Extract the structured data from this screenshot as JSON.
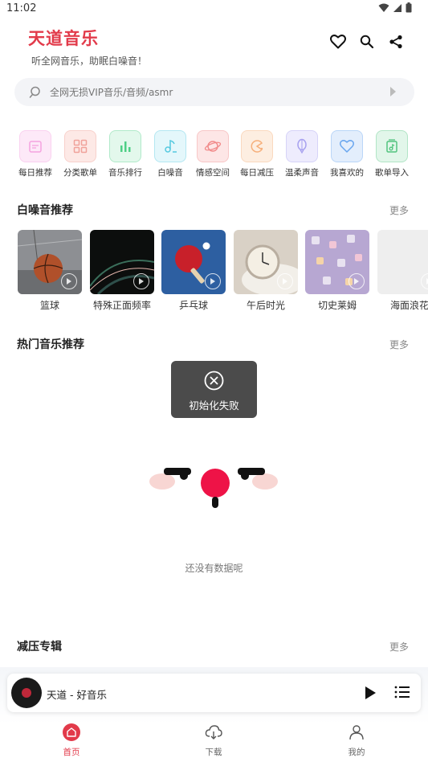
{
  "status": {
    "time": "11:02"
  },
  "header": {
    "title": "天道音乐",
    "subtitle": "听全网音乐，助眠白噪音！"
  },
  "search": {
    "placeholder": "全网无损VIP音乐/音频/asmr"
  },
  "categories": [
    {
      "label": "每日推荐",
      "icon": "calendar-icon",
      "color": "#f5a3e0",
      "bg": "#fde9f8"
    },
    {
      "label": "分类歌单",
      "icon": "grid-icon",
      "color": "#f0a29a",
      "bg": "#fde9e6"
    },
    {
      "label": "音乐排行",
      "icon": "bar-chart-icon",
      "color": "#4fcf86",
      "bg": "#e3f8ec"
    },
    {
      "label": "白噪音",
      "icon": "music-note-icon",
      "color": "#55c9e0",
      "bg": "#e4f7fb"
    },
    {
      "label": "情感空间",
      "icon": "planet-icon",
      "color": "#f18a8a",
      "bg": "#fde6e6"
    },
    {
      "label": "每日减压",
      "icon": "pacman-icon",
      "color": "#f6b07c",
      "bg": "#fdeee1"
    },
    {
      "label": "温柔声音",
      "icon": "balloon-icon",
      "color": "#a7a1ef",
      "bg": "#eeecfd"
    },
    {
      "label": "我喜欢的",
      "icon": "heart-icon",
      "color": "#6aa7ef",
      "bg": "#e3eefc"
    },
    {
      "label": "歌单导入",
      "icon": "playlist-import-icon",
      "color": "#52c47e",
      "bg": "#e2f6ea"
    }
  ],
  "white_noise": {
    "title": "白噪音推荐",
    "more": "更多",
    "items": [
      {
        "label": "篮球",
        "icon": "basketball-image"
      },
      {
        "label": "特殊正面频率",
        "icon": "abstract-lights-image"
      },
      {
        "label": "乒乓球",
        "icon": "ping-pong-image"
      },
      {
        "label": "午后时光",
        "icon": "alarm-clock-image"
      },
      {
        "label": "切史莱姆",
        "icon": "slime-cubes-image"
      },
      {
        "label": "海面浪花",
        "icon": "ocean-image"
      }
    ]
  },
  "hot_music": {
    "title": "热门音乐推荐",
    "more": "更多",
    "empty_text": "还没有数据呢"
  },
  "toast": {
    "text": "初始化失败"
  },
  "relax_album": {
    "title": "减压专辑",
    "more": "更多"
  },
  "player": {
    "title": "天道 - 好音乐"
  },
  "nav": [
    {
      "label": "首页",
      "active": true
    },
    {
      "label": "下载",
      "active": false
    },
    {
      "label": "我的",
      "active": false
    }
  ],
  "colors": {
    "accent": "#e23a4a"
  }
}
